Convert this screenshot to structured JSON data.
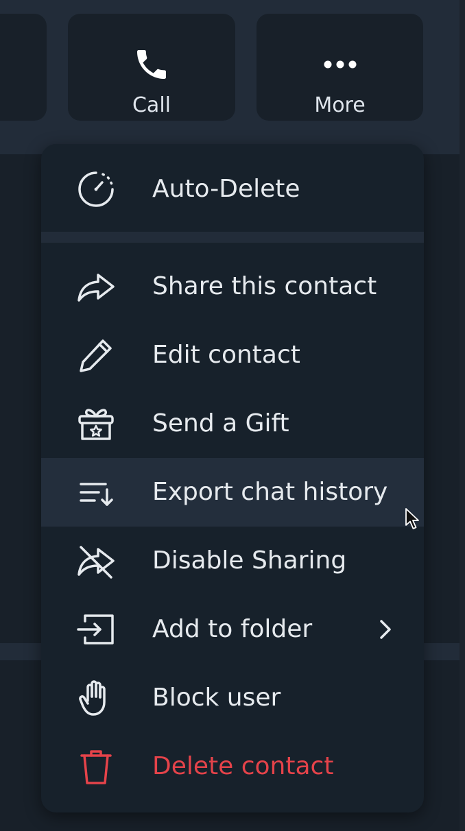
{
  "actions": {
    "call_label": "Call",
    "more_label": "More"
  },
  "menu": {
    "items": [
      {
        "label": "Auto-Delete",
        "icon": "timer-icon"
      },
      {
        "label": "Share this contact",
        "icon": "share-icon"
      },
      {
        "label": "Edit contact",
        "icon": "pencil-icon"
      },
      {
        "label": "Send a Gift",
        "icon": "gift-icon"
      },
      {
        "label": "Export chat history",
        "icon": "export-icon",
        "hovered": true
      },
      {
        "label": "Disable Sharing",
        "icon": "share-off-icon"
      },
      {
        "label": "Add to folder",
        "icon": "folder-add-icon",
        "has_submenu": true
      },
      {
        "label": "Block user",
        "icon": "hand-icon"
      },
      {
        "label": "Delete contact",
        "icon": "trash-icon",
        "danger": true
      }
    ]
  },
  "colors": {
    "background": "#182029",
    "header": "#222c39",
    "menu_bg": "#17212b",
    "hover": "#232e3c",
    "text": "#e6eaee",
    "danger": "#e5434a"
  }
}
